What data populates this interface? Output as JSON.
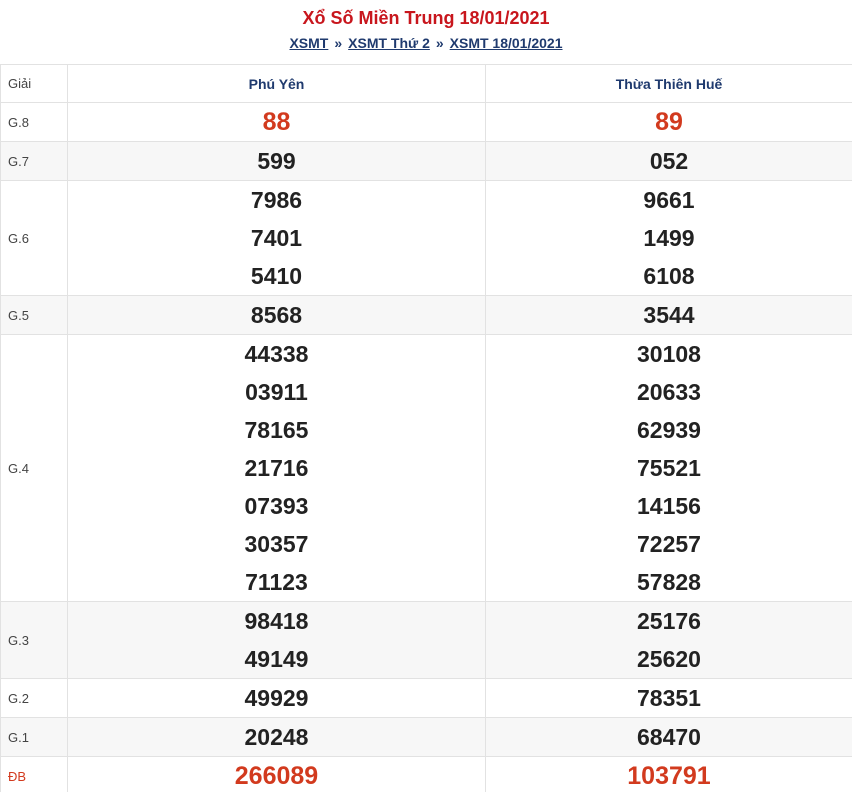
{
  "title": "Xổ Số Miền Trung 18/01/2021",
  "breadcrumb": {
    "item1": "XSMT",
    "sep": "»",
    "item2": "XSMT Thứ 2",
    "item3": "XSMT 18/01/2021"
  },
  "table": {
    "rank_header": "Giải",
    "provinces": [
      "Phú Yên",
      "Thừa Thiên Huế"
    ],
    "rows": [
      {
        "rank": "G.8",
        "col1": [
          "88"
        ],
        "col2": [
          "89"
        ]
      },
      {
        "rank": "G.7",
        "col1": [
          "599"
        ],
        "col2": [
          "052"
        ]
      },
      {
        "rank": "G.6",
        "col1": [
          "7986",
          "7401",
          "5410"
        ],
        "col2": [
          "9661",
          "1499",
          "6108"
        ]
      },
      {
        "rank": "G.5",
        "col1": [
          "8568"
        ],
        "col2": [
          "3544"
        ]
      },
      {
        "rank": "G.4",
        "col1": [
          "44338",
          "03911",
          "78165",
          "21716",
          "07393",
          "30357",
          "71123"
        ],
        "col2": [
          "30108",
          "20633",
          "62939",
          "75521",
          "14156",
          "72257",
          "57828"
        ]
      },
      {
        "rank": "G.3",
        "col1": [
          "98418",
          "49149"
        ],
        "col2": [
          "25176",
          "25620"
        ]
      },
      {
        "rank": "G.2",
        "col1": [
          "49929"
        ],
        "col2": [
          "78351"
        ]
      },
      {
        "rank": "G.1",
        "col1": [
          "20248"
        ],
        "col2": [
          "68470"
        ]
      },
      {
        "rank": "ĐB",
        "col1": [
          "266089"
        ],
        "col2": [
          "103791"
        ]
      }
    ]
  },
  "colors": {
    "title": "#c8161d",
    "link": "#1f3a6e",
    "highlight": "#d23a1e",
    "alt_row": "#f7f7f7"
  }
}
